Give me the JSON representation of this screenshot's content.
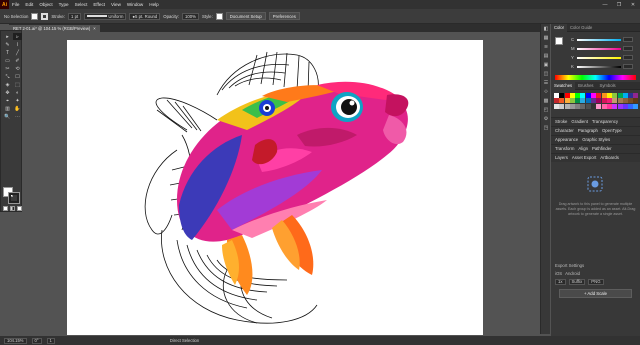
{
  "app": {
    "logo": "Ai"
  },
  "menubar": {
    "items": [
      "File",
      "Edit",
      "Object",
      "Type",
      "Select",
      "Effect",
      "View",
      "Window",
      "Help"
    ],
    "win_controls": [
      "—",
      "❐",
      "✕"
    ]
  },
  "controlbar": {
    "selection_label": "No Selection",
    "stroke_label": "Stroke:",
    "stroke_value": "1 pt",
    "uniform_label": "Uniform",
    "brush_label": "5 pt. Round",
    "opacity_label": "Opacity:",
    "opacity_value": "100%",
    "style_label": "Style:",
    "document_setup": "Document Setup",
    "preferences": "Preferences"
  },
  "document_tab": {
    "title": "RET 2-01.ai* @ 104.15 % (RGB/Preview)",
    "close": "×"
  },
  "tools": [
    "▸",
    "▹",
    "✎",
    "⌇",
    "T",
    "╱",
    "▭",
    "✐",
    "✂",
    "⟲",
    "⤡",
    "☐",
    "◈",
    "⬚",
    "✥",
    "◐",
    "⌖",
    "✦",
    "▥",
    "✋",
    "🔍",
    "⋯"
  ],
  "colors": {
    "panel": "#383838",
    "accent_r": "#d9338f",
    "accent_g": "#6a5acd",
    "accent_b": "#f2c200"
  },
  "right_icons": [
    "◧",
    "▦",
    "≋",
    "▤",
    "▣",
    "◫",
    "☰",
    "⟐",
    "▩",
    "◰",
    "⚙",
    "◳"
  ],
  "color_panel": {
    "tabs": [
      "Color",
      "Color Guide"
    ],
    "sliders": [
      {
        "label": "C",
        "color": "linear-gradient(90deg,#fff,#00aeef)"
      },
      {
        "label": "M",
        "color": "linear-gradient(90deg,#fff,#ec008c)"
      },
      {
        "label": "Y",
        "color": "linear-gradient(90deg,#fff,#fff200)"
      },
      {
        "label": "K",
        "color": "linear-gradient(90deg,#fff,#000)"
      }
    ]
  },
  "swatches_panel": {
    "tabs": [
      "Swatches",
      "Brushes",
      "Symbols"
    ],
    "colors": [
      "#ffffff",
      "#000000",
      "#ff0000",
      "#ffff00",
      "#00ff00",
      "#00ffff",
      "#0000ff",
      "#ff00ff",
      "#ed1c24",
      "#f7941d",
      "#fff200",
      "#8dc63f",
      "#00a651",
      "#00aeef",
      "#2e3192",
      "#92278f",
      "#c1272d",
      "#f15a24",
      "#fbb03b",
      "#8cc63f",
      "#009245",
      "#29abe2",
      "#0071bc",
      "#662d91",
      "#9e005d",
      "#d4145a",
      "#ed1e79",
      "#c69c6d",
      "#a67c52",
      "#8c6239",
      "#754c24",
      "#603813",
      "#e6e6e6",
      "#cccccc",
      "#b3b3b3",
      "#999999",
      "#808080",
      "#666666",
      "#4d4d4d",
      "#333333",
      "#f9c",
      "#f6a",
      "#f39",
      "#c3f",
      "#93f",
      "#63f",
      "#36f",
      "#39f"
    ]
  },
  "sections": {
    "stroke_tabs": [
      "Stroke",
      "Gradient",
      "Transparency"
    ],
    "character_tabs": [
      "Character",
      "Paragraph",
      "OpenType"
    ],
    "appearance_tabs": [
      "Appearance",
      "Graphic Styles"
    ],
    "transform_tabs": [
      "Transform",
      "Align",
      "Pathfinder"
    ],
    "layers_tabs": [
      "Layers",
      "Asset Export",
      "Artboards"
    ]
  },
  "asset_export": {
    "hint": "Drag artwork to this panel to generate multiple assets. Each group is added as an asset. Alt-Drag artwork to generate a single asset.",
    "export_settings_label": "Export Settings",
    "scale_value": "1x",
    "suffix_label": "Suffix",
    "format_value": "PNG",
    "ios_label": "iOS",
    "android_label": "Android",
    "add_scale": "+ Add Scale"
  },
  "statusbar": {
    "zoom": "104.15%",
    "rotation": "0°",
    "artboard_num": "1",
    "tool_name": "Direct Selection"
  }
}
